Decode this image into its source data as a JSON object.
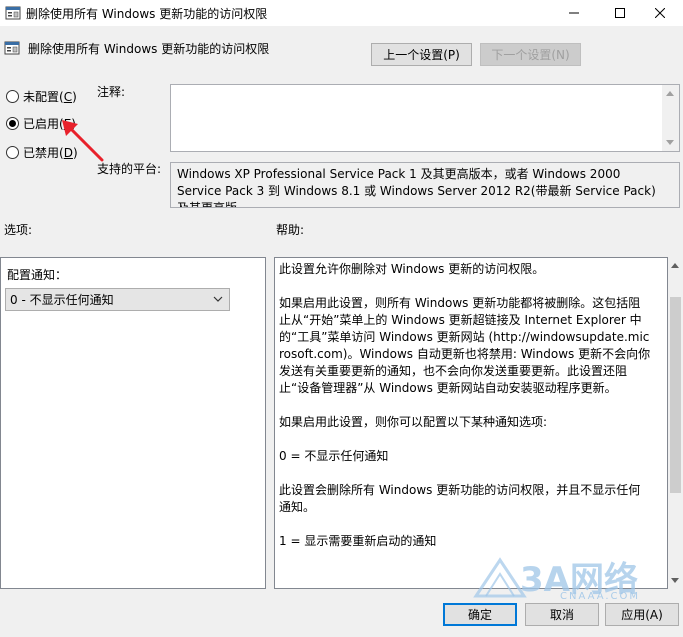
{
  "window": {
    "title": "删除使用所有 Windows 更新功能的访问权限"
  },
  "header": {
    "policy_title": "删除使用所有 Windows 更新功能的访问权限",
    "prev_setting": "上一个设置(P)",
    "next_setting": "下一个设置(N)"
  },
  "state": {
    "options": [
      {
        "label": "未配置(C)",
        "mnemonic": "C",
        "prefix": "未配置(",
        "suffix": ")",
        "checked": false
      },
      {
        "label": "已启用(E)",
        "mnemonic": "E",
        "prefix": "已启用(",
        "suffix": ")",
        "checked": true
      },
      {
        "label": "已禁用(D)",
        "mnemonic": "D",
        "prefix": "已禁用(",
        "suffix": ")",
        "checked": false
      }
    ]
  },
  "comment": {
    "label": "注释:",
    "value": ""
  },
  "platform": {
    "label": "支持的平台:",
    "value": "Windows XP Professional Service Pack 1 及其更高版本，或者 Windows 2000 Service Pack 3 到 Windows 8.1 或 Windows Server 2012 R2(带最新 Service Pack)及其更高版"
  },
  "options_section": {
    "label": "选项:",
    "config_label": "配置通知：",
    "selected_value": "0 - 不显示任何通知"
  },
  "help_section": {
    "label": "帮助:",
    "paragraphs": [
      "此设置允许你删除对 Windows 更新的访问权限。",
      "如果启用此设置，则所有 Windows 更新功能都将被删除。这包括阻止从“开始”菜单上的 Windows 更新超链接及 Internet Explorer 中的“工具”菜单访问 Windows 更新网站 (http://windowsupdate.microsoft.com)。Windows 自动更新也将禁用: Windows 更新不会向你发送有关重要更新的通知，也不会向你发送重要更新。此设置还阻止“设备管理器”从 Windows 更新网站自动安装驱动程序更新。",
      "如果启用此设置，则你可以配置以下某种通知选项:",
      "0 = 不显示任何通知",
      "此设置会删除所有 Windows 更新功能的访问权限，并且不显示任何通知。",
      "1 = 显示需要重新启动的通知"
    ]
  },
  "footer": {
    "ok": "确定",
    "cancel": "取消",
    "apply": "应用(A)"
  },
  "watermark": {
    "text": "3A网络",
    "sub": "CNAAA.COM"
  },
  "colors": {
    "accent": "#0078d7",
    "annotation_arrow": "#e8212b",
    "watermark": "#9fc6e8"
  }
}
